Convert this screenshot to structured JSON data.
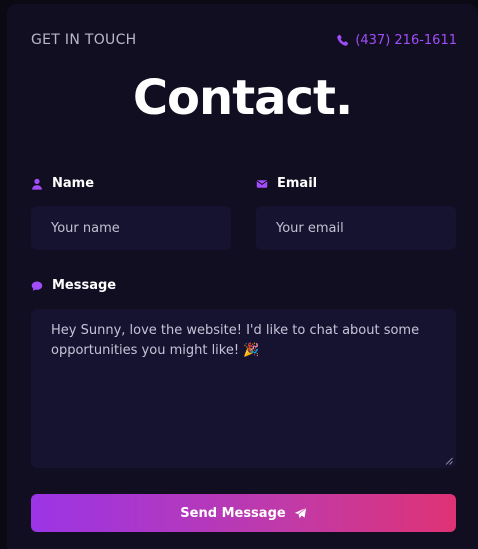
{
  "header": {
    "eyebrow": "GET IN TOUCH",
    "phone": "(437) 216-1611",
    "title": "Contact."
  },
  "form": {
    "name_label": "Name",
    "name_placeholder": "Your name",
    "email_label": "Email",
    "email_placeholder": "Your email",
    "message_label": "Message",
    "message_value": "Hey Sunny, love the website! I'd like to chat about some opportunities you might like! 🎉",
    "submit_label": "Send Message"
  },
  "icons": {
    "phone": "phone-icon",
    "name": "user-icon",
    "email": "envelope-icon",
    "message": "comment-icon",
    "submit": "paper-plane-icon"
  },
  "colors": {
    "accent": "#a24dfa",
    "card_bg": "#100e20",
    "field_bg": "#161330",
    "button_gradient_start": "#9b35e6",
    "button_gradient_end": "#df3275"
  }
}
